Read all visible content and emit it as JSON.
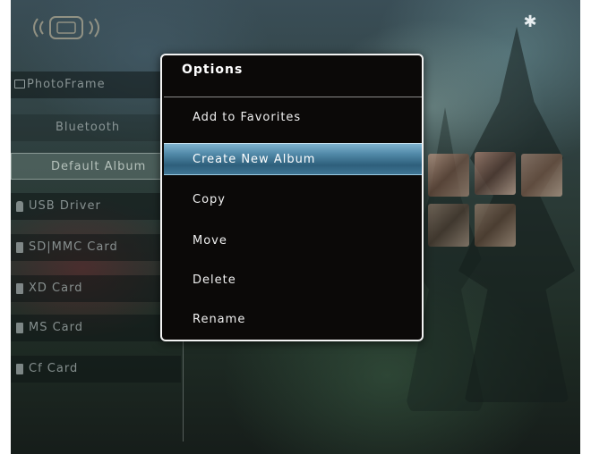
{
  "status_bar": {
    "logo_icon": "device-logo-icon",
    "bluetooth_icon": "bluetooth-icon",
    "bluetooth_glyph": "✱"
  },
  "sources": {
    "header": "PhotoFrame",
    "items": [
      {
        "label": "Bluetooth",
        "icon": ""
      },
      {
        "label": "Default Album",
        "icon": ""
      },
      {
        "label": "USB Driver",
        "icon": "usb-icon"
      },
      {
        "label": "SD|MMC Card",
        "icon": "card-icon"
      },
      {
        "label": "XD Card",
        "icon": "card-icon"
      },
      {
        "label": "MS Card",
        "icon": "card-icon"
      },
      {
        "label": "Cf Card",
        "icon": "card-icon"
      }
    ],
    "selected": "Default Album"
  },
  "options_menu": {
    "title": "Options",
    "items": [
      {
        "label": "Add to Favorites"
      },
      {
        "label": "Create New Album"
      },
      {
        "label": "Copy"
      },
      {
        "label": "Move"
      },
      {
        "label": "Delete"
      },
      {
        "label": "Rename"
      }
    ],
    "highlighted": "Create New Album"
  },
  "colors": {
    "highlight": "#4f87a6",
    "popup_background": "#0b0908",
    "popup_border": "#f2f2f2"
  }
}
